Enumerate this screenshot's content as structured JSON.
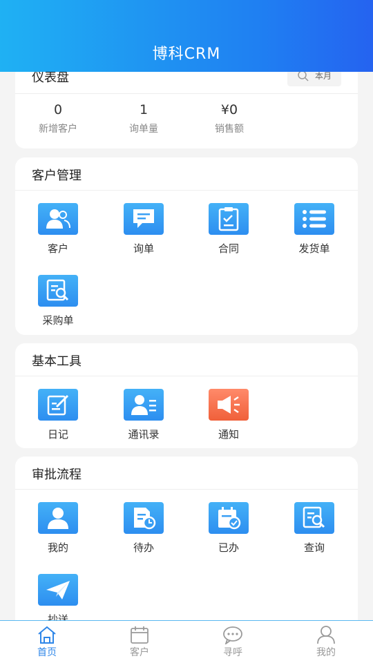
{
  "header": {
    "title": "博科CRM"
  },
  "dashboard": {
    "title": "仪表盘",
    "filter_label": "本月",
    "stats": [
      {
        "value": "0",
        "label": "新增客户"
      },
      {
        "value": "1",
        "label": "询单量"
      },
      {
        "value": "¥0",
        "label": "销售额"
      }
    ]
  },
  "customer_mgmt": {
    "title": "客户管理",
    "items": [
      {
        "label": "客户",
        "icon": "customers-icon"
      },
      {
        "label": "询单",
        "icon": "inquiry-icon"
      },
      {
        "label": "合同",
        "icon": "contract-icon"
      },
      {
        "label": "发货单",
        "icon": "list-icon"
      },
      {
        "label": "采购单",
        "icon": "purchase-search-icon"
      }
    ]
  },
  "tools": {
    "title": "基本工具",
    "items": [
      {
        "label": "日记",
        "icon": "diary-icon"
      },
      {
        "label": "通讯录",
        "icon": "contacts-icon"
      },
      {
        "label": "通知",
        "icon": "megaphone-icon"
      }
    ]
  },
  "approval": {
    "title": "审批流程",
    "items": [
      {
        "label": "我的",
        "icon": "user-icon"
      },
      {
        "label": "待办",
        "icon": "pending-icon"
      },
      {
        "label": "已办",
        "icon": "done-calendar-icon"
      },
      {
        "label": "查询",
        "icon": "query-icon"
      },
      {
        "label": "抄送",
        "icon": "send-icon"
      }
    ]
  },
  "tabbar": {
    "tabs": [
      {
        "label": "首页",
        "icon": "home-icon",
        "active": true
      },
      {
        "label": "客户",
        "icon": "calendar-icon",
        "active": false
      },
      {
        "label": "寻呼",
        "icon": "chat-icon",
        "active": false
      },
      {
        "label": "我的",
        "icon": "profile-icon",
        "active": false
      }
    ]
  },
  "colors": {
    "accent": "#2e86e8",
    "header_start": "#1fb1f3",
    "header_end": "#2563f0",
    "tile": "#3a9ff4",
    "notice_tile": "#f06a44"
  }
}
